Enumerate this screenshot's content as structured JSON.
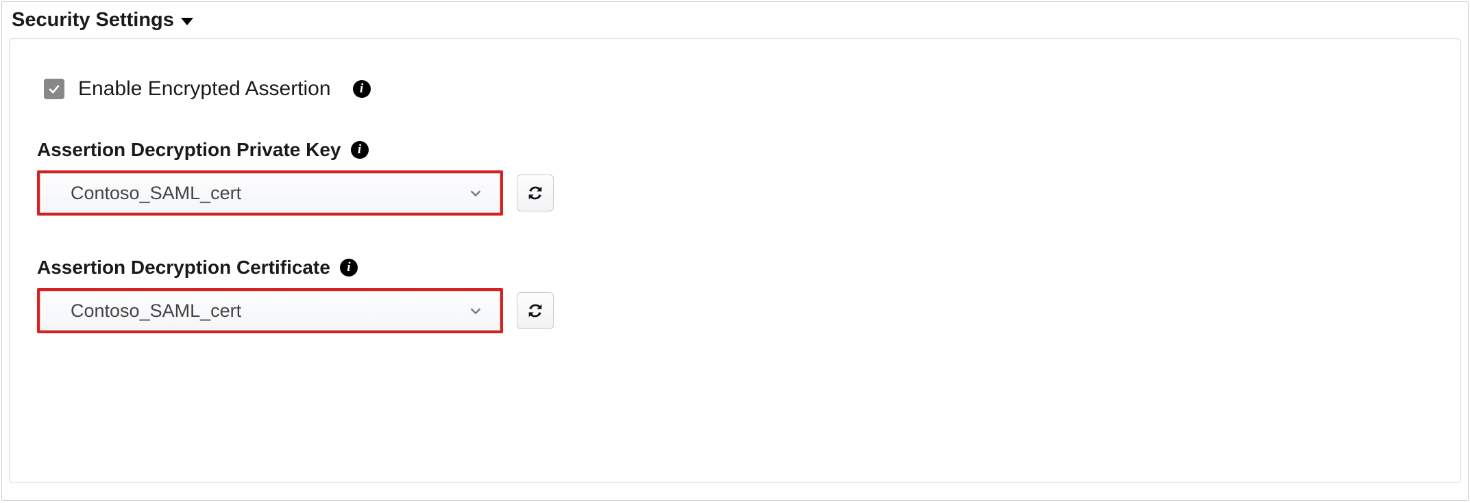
{
  "section": {
    "title": "Security Settings"
  },
  "encrypted_assertion": {
    "label": "Enable Encrypted Assertion",
    "checked": true
  },
  "fields": {
    "private_key": {
      "label": "Assertion Decryption Private Key",
      "value": "Contoso_SAML_cert"
    },
    "certificate": {
      "label": "Assertion Decryption Certificate",
      "value": "Contoso_SAML_cert"
    }
  }
}
